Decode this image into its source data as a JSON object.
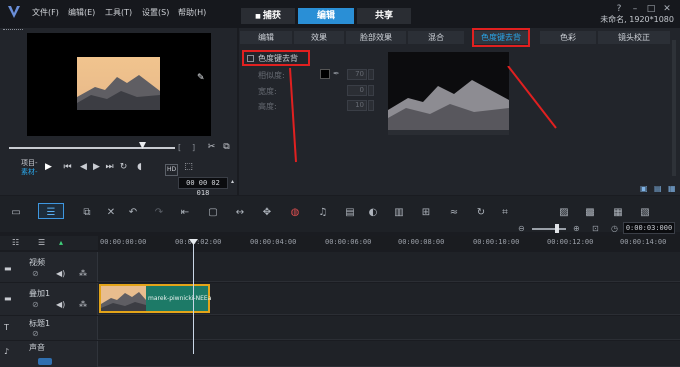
{
  "app": {
    "logo": "V"
  },
  "menu": [
    "文件(F)",
    "编辑(E)",
    "工具(T)",
    "设置(S)",
    "帮助(H)"
  ],
  "main_tabs": [
    "捕获",
    "编辑",
    "共享"
  ],
  "project": {
    "label": "未命名, 1920*1080"
  },
  "player": {
    "mode_project": "项目-",
    "mode_clip": "素材-",
    "timecode": "00 00 02 018",
    "quality": "HD"
  },
  "effect_tabs": [
    "编辑",
    "效果",
    "脸部效果",
    "混合",
    "色度键去背",
    "色彩",
    "镜头校正"
  ],
  "chroma": {
    "checkbox_label": "色度键去背",
    "fields": [
      {
        "label": "相似度:",
        "value": "70"
      },
      {
        "label": "宽度:",
        "value": "0"
      },
      {
        "label": "高度:",
        "value": "10"
      }
    ]
  },
  "timeline": {
    "ticks": [
      "00:00:00:00",
      "00:00:02:00",
      "00:00:04:00",
      "00:00:06:00",
      "00:00:08:00",
      "00:00:10:00",
      "00:00:12:00",
      "00:00:14:00"
    ],
    "zoom_timecode": "0:00:03:000",
    "tracks": [
      {
        "name": "视频"
      },
      {
        "name": "叠加1"
      },
      {
        "name": "标题1"
      },
      {
        "name": "声音"
      }
    ],
    "clip_name": "marek-piwnicki-NEEa"
  },
  "colors": {
    "accent": "#2a8fd6",
    "highlight": "#e02020",
    "clip": "#1d7a67",
    "clip_border": "#e3a419"
  }
}
